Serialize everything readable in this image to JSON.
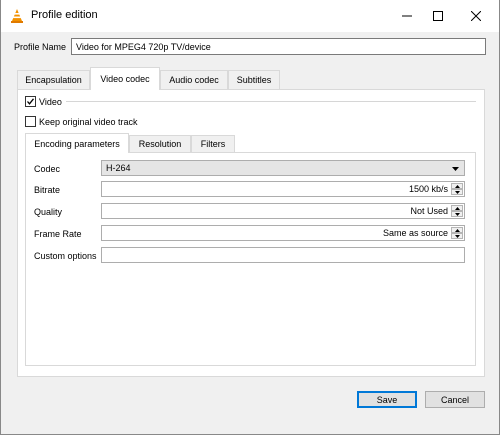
{
  "window": {
    "title": "Profile edition"
  },
  "profile": {
    "label": "Profile Name",
    "value": "Video for MPEG4 720p TV/device"
  },
  "tabs": [
    {
      "label": "Encapsulation",
      "active": false
    },
    {
      "label": "Video codec",
      "active": true
    },
    {
      "label": "Audio codec",
      "active": false
    },
    {
      "label": "Subtitles",
      "active": false
    }
  ],
  "video": {
    "enable_label": "Video",
    "enable_checked": true,
    "keep_original_label": "Keep original video track",
    "keep_original_checked": false
  },
  "subtabs": [
    {
      "label": "Encoding parameters",
      "active": true
    },
    {
      "label": "Resolution",
      "active": false
    },
    {
      "label": "Filters",
      "active": false
    }
  ],
  "encoding": {
    "codec_label": "Codec",
    "codec_value": "H-264",
    "bitrate_label": "Bitrate",
    "bitrate_value": "1500 kb/s",
    "quality_label": "Quality",
    "quality_value": "Not Used",
    "framerate_label": "Frame Rate",
    "framerate_value": "Same as source",
    "custom_label": "Custom options",
    "custom_value": ""
  },
  "buttons": {
    "save": "Save",
    "cancel": "Cancel"
  }
}
